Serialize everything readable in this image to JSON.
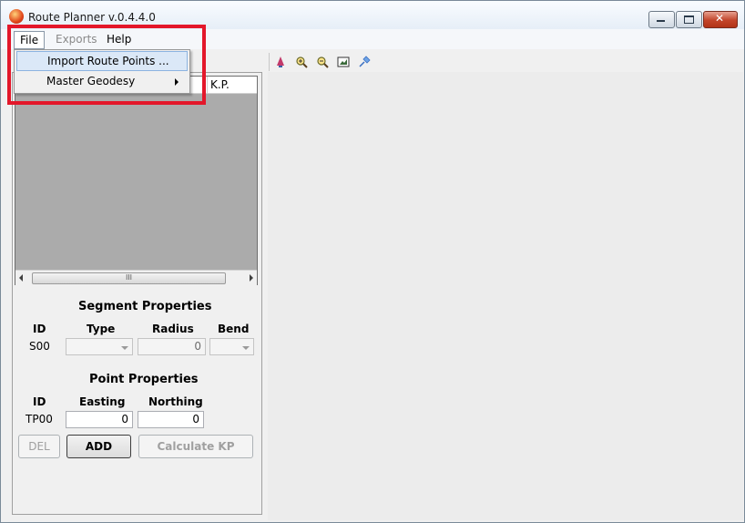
{
  "window": {
    "title": "Route Planner v.0.4.4.0"
  },
  "menubar": {
    "file": "File",
    "exports": "Exports",
    "help": "Help"
  },
  "file_menu": {
    "import_route_points": "Import Route Points ...",
    "master_geodesy": "Master Geodesy"
  },
  "toolbar": {
    "icons": [
      "pan-icon",
      "zoom-in-icon",
      "zoom-out-icon",
      "zoom-extents-icon",
      "pin-icon"
    ]
  },
  "grid": {
    "columns": [
      "K.P."
    ],
    "scroll_thumb_grip": "III"
  },
  "segment": {
    "title": "Segment Properties",
    "id_label": "ID",
    "type_label": "Type",
    "radius_label": "Radius",
    "bend_label": "Bend",
    "id_value": "S00",
    "radius_value": "0"
  },
  "point": {
    "title": "Point Properties",
    "id_label": "ID",
    "easting_label": "Easting",
    "northing_label": "Northing",
    "id_value": "TP00",
    "easting_value": "0",
    "northing_value": "0"
  },
  "buttons": {
    "del": "DEL",
    "add": "ADD",
    "calculate_kp": "Calculate KP"
  },
  "colors": {
    "highlight": "#e3172a",
    "menu_hover": "#dbe8f7"
  }
}
